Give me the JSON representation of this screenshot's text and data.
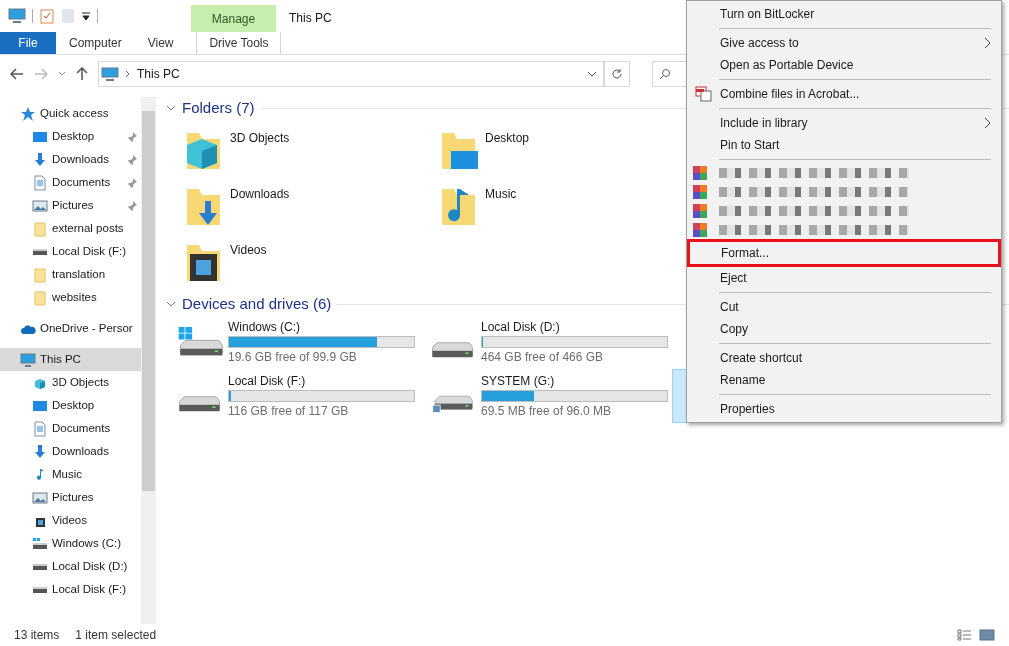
{
  "title_bar": {
    "contextual_tab": "Manage",
    "title": "This PC"
  },
  "ribbon_tabs": [
    {
      "label": "File",
      "kind": "file",
      "selected": false
    },
    {
      "label": "Computer",
      "kind": "tab",
      "selected": false
    },
    {
      "label": "View",
      "kind": "tab",
      "selected": false
    },
    {
      "label": "Drive Tools",
      "kind": "contextual",
      "selected": false
    }
  ],
  "address_bar": {
    "path": "This PC"
  },
  "sidebar": {
    "items": [
      {
        "label": "Quick access",
        "kind": "star",
        "selected": false,
        "children": [
          {
            "label": "Desktop",
            "kind": "desktop",
            "pinned": true,
            "selected": false
          },
          {
            "label": "Downloads",
            "kind": "downloads",
            "pinned": true,
            "selected": false
          },
          {
            "label": "Documents",
            "kind": "documents",
            "pinned": true,
            "selected": false
          },
          {
            "label": "Pictures",
            "kind": "pictures",
            "pinned": true,
            "selected": false
          },
          {
            "label": "external posts",
            "kind": "folder",
            "pinned": false,
            "selected": false
          },
          {
            "label": "Local Disk (F:)",
            "kind": "drive",
            "pinned": false,
            "selected": false
          },
          {
            "label": "translation",
            "kind": "folder",
            "pinned": false,
            "selected": false
          },
          {
            "label": "websites",
            "kind": "folder",
            "pinned": false,
            "selected": false
          }
        ]
      },
      {
        "label": "OneDrive - Persor",
        "kind": "cloud",
        "selected": false
      },
      {
        "label": "This PC",
        "kind": "pc",
        "selected": true,
        "children": [
          {
            "label": "3D Objects",
            "kind": "cube",
            "pinned": false,
            "selected": false
          },
          {
            "label": "Desktop",
            "kind": "desktop",
            "pinned": false,
            "selected": false
          },
          {
            "label": "Documents",
            "kind": "documents",
            "pinned": false,
            "selected": false
          },
          {
            "label": "Downloads",
            "kind": "downloads",
            "pinned": false,
            "selected": false
          },
          {
            "label": "Music",
            "kind": "music",
            "pinned": false,
            "selected": false
          },
          {
            "label": "Pictures",
            "kind": "pictures",
            "pinned": false,
            "selected": false
          },
          {
            "label": "Videos",
            "kind": "videos",
            "pinned": false,
            "selected": false
          },
          {
            "label": "Windows (C:)",
            "kind": "windows",
            "pinned": false,
            "selected": false
          },
          {
            "label": "Local Disk (D:)",
            "kind": "drive",
            "pinned": false,
            "selected": false
          },
          {
            "label": "Local Disk (F:)",
            "kind": "drive",
            "pinned": false,
            "selected": false
          }
        ]
      }
    ]
  },
  "folders": {
    "heading": "Folders (7)",
    "items": [
      {
        "label": "3D Objects",
        "kind": "cube"
      },
      {
        "label": "Desktop",
        "kind": "desktop"
      },
      {
        "label": "Downloads",
        "kind": "downloads"
      },
      {
        "label": "Music",
        "kind": "music"
      },
      {
        "label": "Videos",
        "kind": "videos"
      }
    ]
  },
  "drives": {
    "heading": "Devices and drives (6)",
    "rows": [
      [
        {
          "name": "Windows (C:)",
          "kind": "windows",
          "level": 0.8,
          "free": "19.6 GB free of 99.9 GB",
          "selected": false
        },
        {
          "name": "Local Disk (D:)",
          "kind": "drive",
          "level": 0.004,
          "free": "464 GB free of 466 GB",
          "selected": false
        }
      ],
      [
        {
          "name": "Local Disk (F:)",
          "kind": "drive",
          "level": 0.01,
          "free": "116 GB free of 117 GB",
          "selected": false
        },
        {
          "name": "SYSTEM (G:)",
          "kind": "shared",
          "level": 0.28,
          "free": "69.5 MB free of 96.0 MB",
          "selected": false
        },
        {
          "kind": "hidden",
          "selected": true
        }
      ]
    ]
  },
  "context_menu": {
    "items": [
      {
        "kind": "item",
        "label": "Turn on BitLocker"
      },
      {
        "kind": "separator"
      },
      {
        "kind": "submenu",
        "label": "Give access to"
      },
      {
        "kind": "item",
        "label": "Open as Portable Device"
      },
      {
        "kind": "separator"
      },
      {
        "kind": "acrobat",
        "label": "Combine files in Acrobat..."
      },
      {
        "kind": "separator"
      },
      {
        "kind": "submenu",
        "label": "Include in library"
      },
      {
        "kind": "item",
        "label": "Pin to Start"
      },
      {
        "kind": "separator"
      },
      {
        "kind": "redacted"
      },
      {
        "kind": "redacted"
      },
      {
        "kind": "redacted"
      },
      {
        "kind": "redacted"
      },
      {
        "kind": "item",
        "label": "Format...",
        "highlighted": true
      },
      {
        "kind": "item",
        "label": "Eject"
      },
      {
        "kind": "separator"
      },
      {
        "kind": "item",
        "label": "Cut"
      },
      {
        "kind": "item",
        "label": "Copy"
      },
      {
        "kind": "separator"
      },
      {
        "kind": "item",
        "label": "Create shortcut"
      },
      {
        "kind": "item",
        "label": "Rename"
      },
      {
        "kind": "separator"
      },
      {
        "kind": "item",
        "label": "Properties"
      }
    ]
  },
  "status_bar": {
    "count": "13 items",
    "selection": "1 item selected"
  }
}
